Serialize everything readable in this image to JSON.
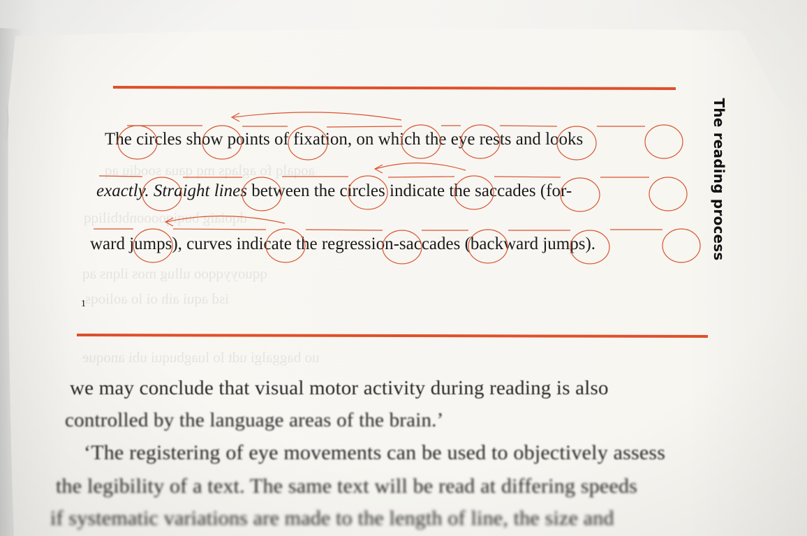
{
  "page": {
    "side_title": "The reading process",
    "figure_number": "1",
    "figure_lines": [
      {
        "segments": [
          {
            "t": "The circles show points of fixation, on which the eye rests and looks",
            "i": false
          }
        ]
      },
      {
        "segments": [
          {
            "t": "exactly. Straight lines",
            "i": true
          },
          {
            "t": " between the circles indicate the saccades (for-",
            "i": false
          }
        ]
      },
      {
        "segments": [
          {
            "t": "ward jumps), curves indicate the regression-saccades (backward jumps).",
            "i": false
          }
        ]
      }
    ],
    "body_lines": [
      "we may conclude that visual motor activity during reading is also",
      "controlled by the language areas of the brain.’",
      "‘The registering of eye movements can be used to objectively assess",
      "the legibility of a text. The same text will be read at differing speeds",
      "if systematic variations are made to the length of line, the size and"
    ]
  },
  "colors": {
    "rule": "#e0502a",
    "annotation": "#d9542f",
    "ink": "#1a1a1a",
    "paper": "#f7f6f1"
  }
}
